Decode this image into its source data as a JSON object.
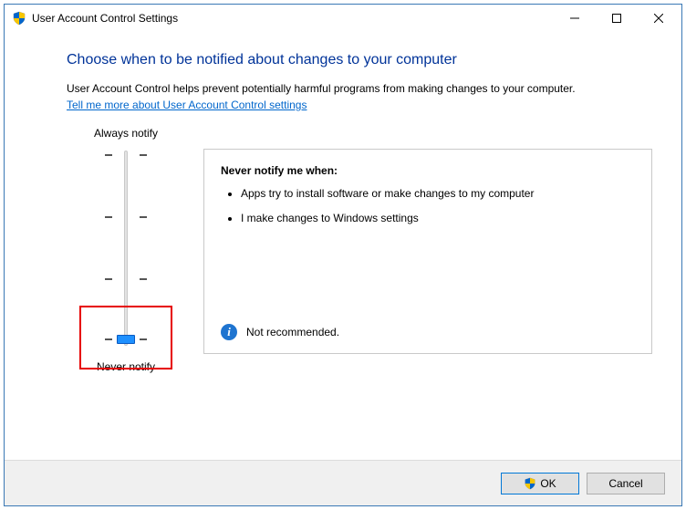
{
  "window": {
    "title": "User Account Control Settings"
  },
  "content": {
    "headline": "Choose when to be notified about changes to your computer",
    "description": "User Account Control helps prevent potentially harmful programs from making changes to your computer.",
    "link": "Tell me more about User Account Control settings"
  },
  "slider": {
    "top_label": "Always notify",
    "bottom_label": "Never notify",
    "levels": 4,
    "current_index": 3
  },
  "panel": {
    "title": "Never notify me when:",
    "bullets": [
      "Apps try to install software or make changes to my computer",
      "I make changes to Windows settings"
    ],
    "footer_text": "Not recommended."
  },
  "buttons": {
    "ok": "OK",
    "cancel": "Cancel"
  },
  "icons": {
    "info_glyph": "i"
  }
}
